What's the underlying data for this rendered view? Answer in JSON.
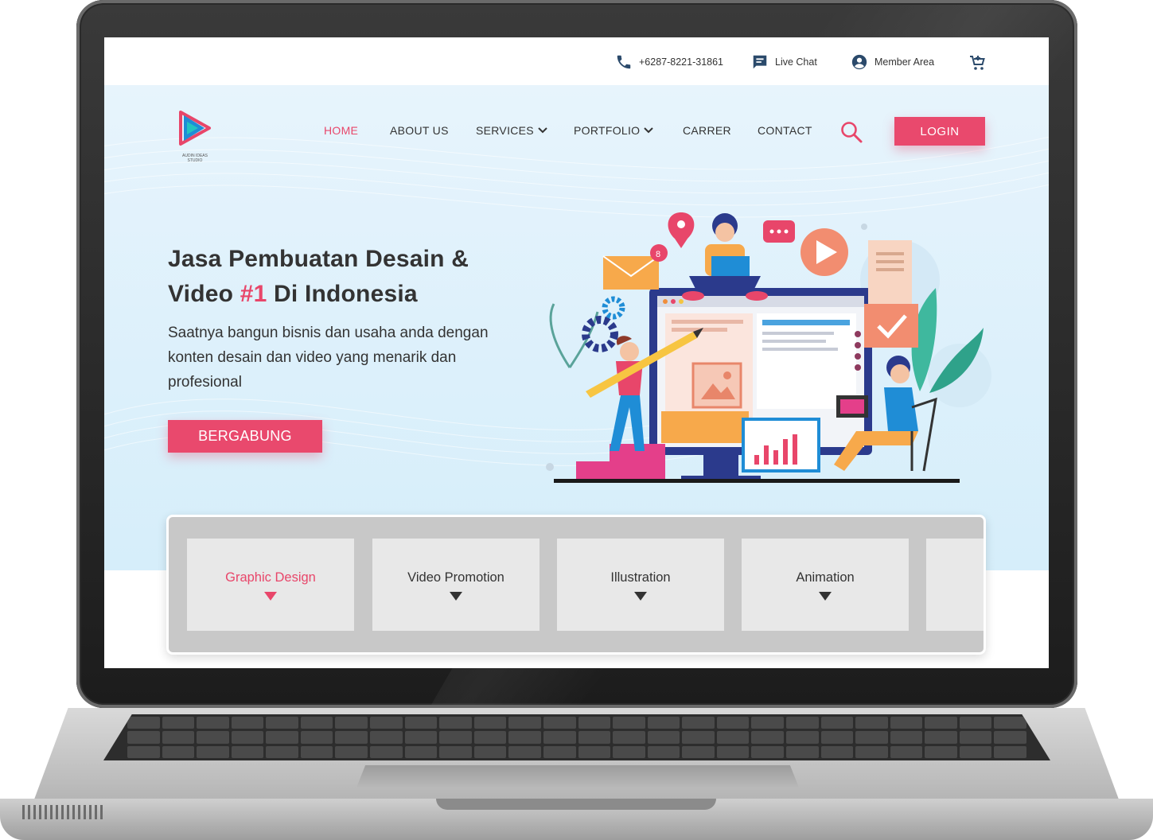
{
  "topbar": {
    "phone": "+6287-8221-31861",
    "live_chat": "Live Chat",
    "member_area": "Member Area"
  },
  "brand": {
    "logo_text": "AUDIN IDEAS STUDIO"
  },
  "nav": {
    "home": "HOME",
    "about": "ABOUT US",
    "services": "SERVICES",
    "portfolio": "PORTFOLIO",
    "carrer": "CARRER",
    "contact": "CONTACT",
    "login": "LOGIN"
  },
  "hero": {
    "title_line1": "Jasa Pembuatan Desain &",
    "title_pre": "Video ",
    "title_highlight": "#1",
    "title_post": " Di Indonesia",
    "subtitle": "Saatnya bangun bisnis dan usaha anda dengan konten desain dan video yang menarik dan profesional",
    "cta": "BERGABUNG",
    "notification_count": "8"
  },
  "categories": [
    {
      "label": "Graphic Design",
      "active": true
    },
    {
      "label": "Video Promotion",
      "active": false
    },
    {
      "label": "Illustration",
      "active": false
    },
    {
      "label": "Animation",
      "active": false
    }
  ],
  "colors": {
    "accent": "#e9496d",
    "hero_bg": "#e0f2fb",
    "panel_bg": "#c8c8c8",
    "card_bg": "#e8e8e8"
  }
}
